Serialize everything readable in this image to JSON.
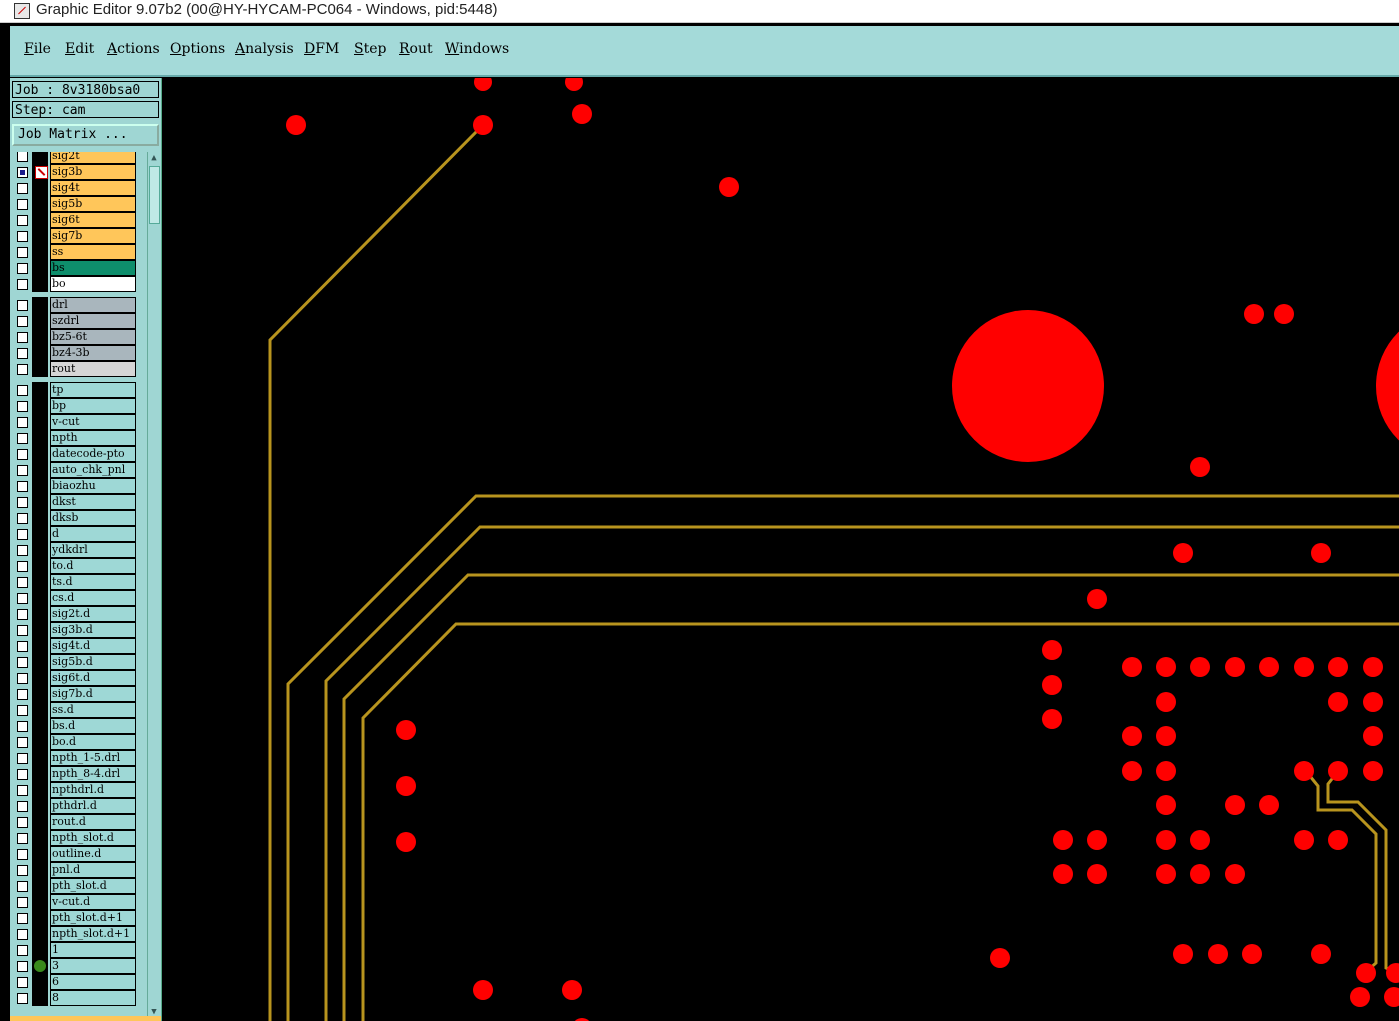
{
  "window": {
    "title": "Graphic Editor 9.07b2 (00@HY-HYCAM-PC064 - Windows, pid:5448)"
  },
  "menu": [
    "File",
    "Edit",
    "Actions",
    "Options",
    "Analysis",
    "DFM",
    "Step",
    "Rout",
    "Windows"
  ],
  "panel": {
    "job": "Job : 8v3180bsa0",
    "step": "Step: cam",
    "job_matrix": "Job Matrix ..."
  },
  "layers": [
    {
      "name": "sig2t",
      "color": "orange",
      "checked": false
    },
    {
      "name": "sig3b",
      "color": "orange",
      "checked": true,
      "selected": true
    },
    {
      "name": "sig4t",
      "color": "orange",
      "checked": false
    },
    {
      "name": "sig5b",
      "color": "orange",
      "checked": false
    },
    {
      "name": "sig6t",
      "color": "orange",
      "checked": false
    },
    {
      "name": "sig7b",
      "color": "orange",
      "checked": false
    },
    {
      "name": "ss",
      "color": "orange",
      "checked": false
    },
    {
      "name": "bs",
      "color": "green",
      "checked": false
    },
    {
      "name": "bo",
      "color": "white",
      "checked": false
    },
    {
      "name": "drl",
      "color": "grey",
      "checked": false
    },
    {
      "name": "szdrl",
      "color": "grey",
      "checked": false
    },
    {
      "name": "bz5-6t",
      "color": "grey",
      "checked": false
    },
    {
      "name": "bz4-3b",
      "color": "grey",
      "checked": false
    },
    {
      "name": "rout",
      "color": "lgrey",
      "checked": false
    },
    {
      "name": "tp",
      "color": "cyan",
      "checked": false
    },
    {
      "name": "bp",
      "color": "cyan",
      "checked": false
    },
    {
      "name": "v-cut",
      "color": "cyan",
      "checked": false
    },
    {
      "name": "npth",
      "color": "cyan",
      "checked": false
    },
    {
      "name": "datecode-pto",
      "color": "cyan",
      "checked": false
    },
    {
      "name": "auto_chk_pnl",
      "color": "cyan",
      "checked": false
    },
    {
      "name": "biaozhu",
      "color": "cyan",
      "checked": false
    },
    {
      "name": "dkst",
      "color": "cyan",
      "checked": false
    },
    {
      "name": "dksb",
      "color": "cyan",
      "checked": false
    },
    {
      "name": "d",
      "color": "cyan",
      "checked": false
    },
    {
      "name": "ydkdrl",
      "color": "cyan",
      "checked": false
    },
    {
      "name": "to.d",
      "color": "cyan",
      "checked": false
    },
    {
      "name": "ts.d",
      "color": "cyan",
      "checked": false
    },
    {
      "name": "cs.d",
      "color": "cyan",
      "checked": false
    },
    {
      "name": "sig2t.d",
      "color": "cyan",
      "checked": false
    },
    {
      "name": "sig3b.d",
      "color": "cyan",
      "checked": false
    },
    {
      "name": "sig4t.d",
      "color": "cyan",
      "checked": false
    },
    {
      "name": "sig5b.d",
      "color": "cyan",
      "checked": false
    },
    {
      "name": "sig6t.d",
      "color": "cyan",
      "checked": false
    },
    {
      "name": "sig7b.d",
      "color": "cyan",
      "checked": false
    },
    {
      "name": "ss.d",
      "color": "cyan",
      "checked": false
    },
    {
      "name": "bs.d",
      "color": "cyan",
      "checked": false
    },
    {
      "name": "bo.d",
      "color": "cyan",
      "checked": false
    },
    {
      "name": "npth_1-5.drl",
      "color": "cyan",
      "checked": false
    },
    {
      "name": "npth_8-4.drl",
      "color": "cyan",
      "checked": false
    },
    {
      "name": "npthdrl.d",
      "color": "cyan",
      "checked": false
    },
    {
      "name": "pthdrl.d",
      "color": "cyan",
      "checked": false
    },
    {
      "name": "rout.d",
      "color": "cyan",
      "checked": false
    },
    {
      "name": "npth_slot.d",
      "color": "cyan",
      "checked": false
    },
    {
      "name": "outline.d",
      "color": "cyan",
      "checked": false
    },
    {
      "name": "pnl.d",
      "color": "cyan",
      "checked": false
    },
    {
      "name": "pth_slot.d",
      "color": "cyan",
      "checked": false
    },
    {
      "name": "v-cut.d",
      "color": "cyan",
      "checked": false
    },
    {
      "name": "pth_slot.d+1",
      "color": "cyan",
      "checked": false
    },
    {
      "name": "npth_slot.d+1",
      "color": "cyan",
      "checked": false
    },
    {
      "name": "1",
      "color": "cyan",
      "checked": false
    },
    {
      "name": "3",
      "color": "cyan",
      "checked": false,
      "active": true
    },
    {
      "name": "6",
      "color": "cyan",
      "checked": false
    },
    {
      "name": "8",
      "color": "cyan",
      "checked": false
    }
  ],
  "colors": {
    "pad": "#ff0000",
    "trace": "#b8941e",
    "canvas_bg": "#000000",
    "panel_bg": "#9fd6d3",
    "menubar_bg": "#a4dad9"
  }
}
